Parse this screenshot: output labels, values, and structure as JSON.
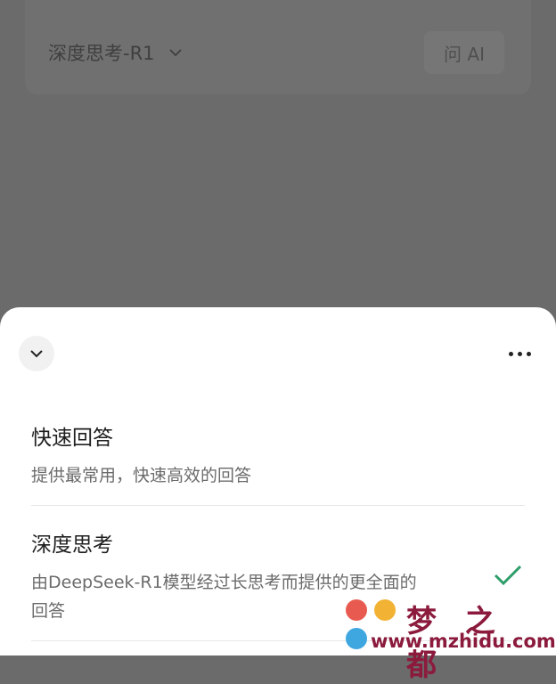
{
  "header": {
    "model_label": "深度思考-R1",
    "ask_ai_label": "问 AI"
  },
  "sheet": {
    "options": [
      {
        "title": "快速回答",
        "description": "提供最常用，快速高效的回答",
        "selected": false
      },
      {
        "title": "深度思考",
        "description_line1": "由DeepSeek-R1模型经过长思考而提供的更全面的",
        "description_line2": "回答",
        "selected": true
      }
    ]
  },
  "watermark": {
    "name": "梦 之 都",
    "url": "www.mzhidu.com"
  },
  "colors": {
    "overlay": "#6b6b6b",
    "check": "#2e9e6a",
    "watermark": "#8b1a3c"
  }
}
